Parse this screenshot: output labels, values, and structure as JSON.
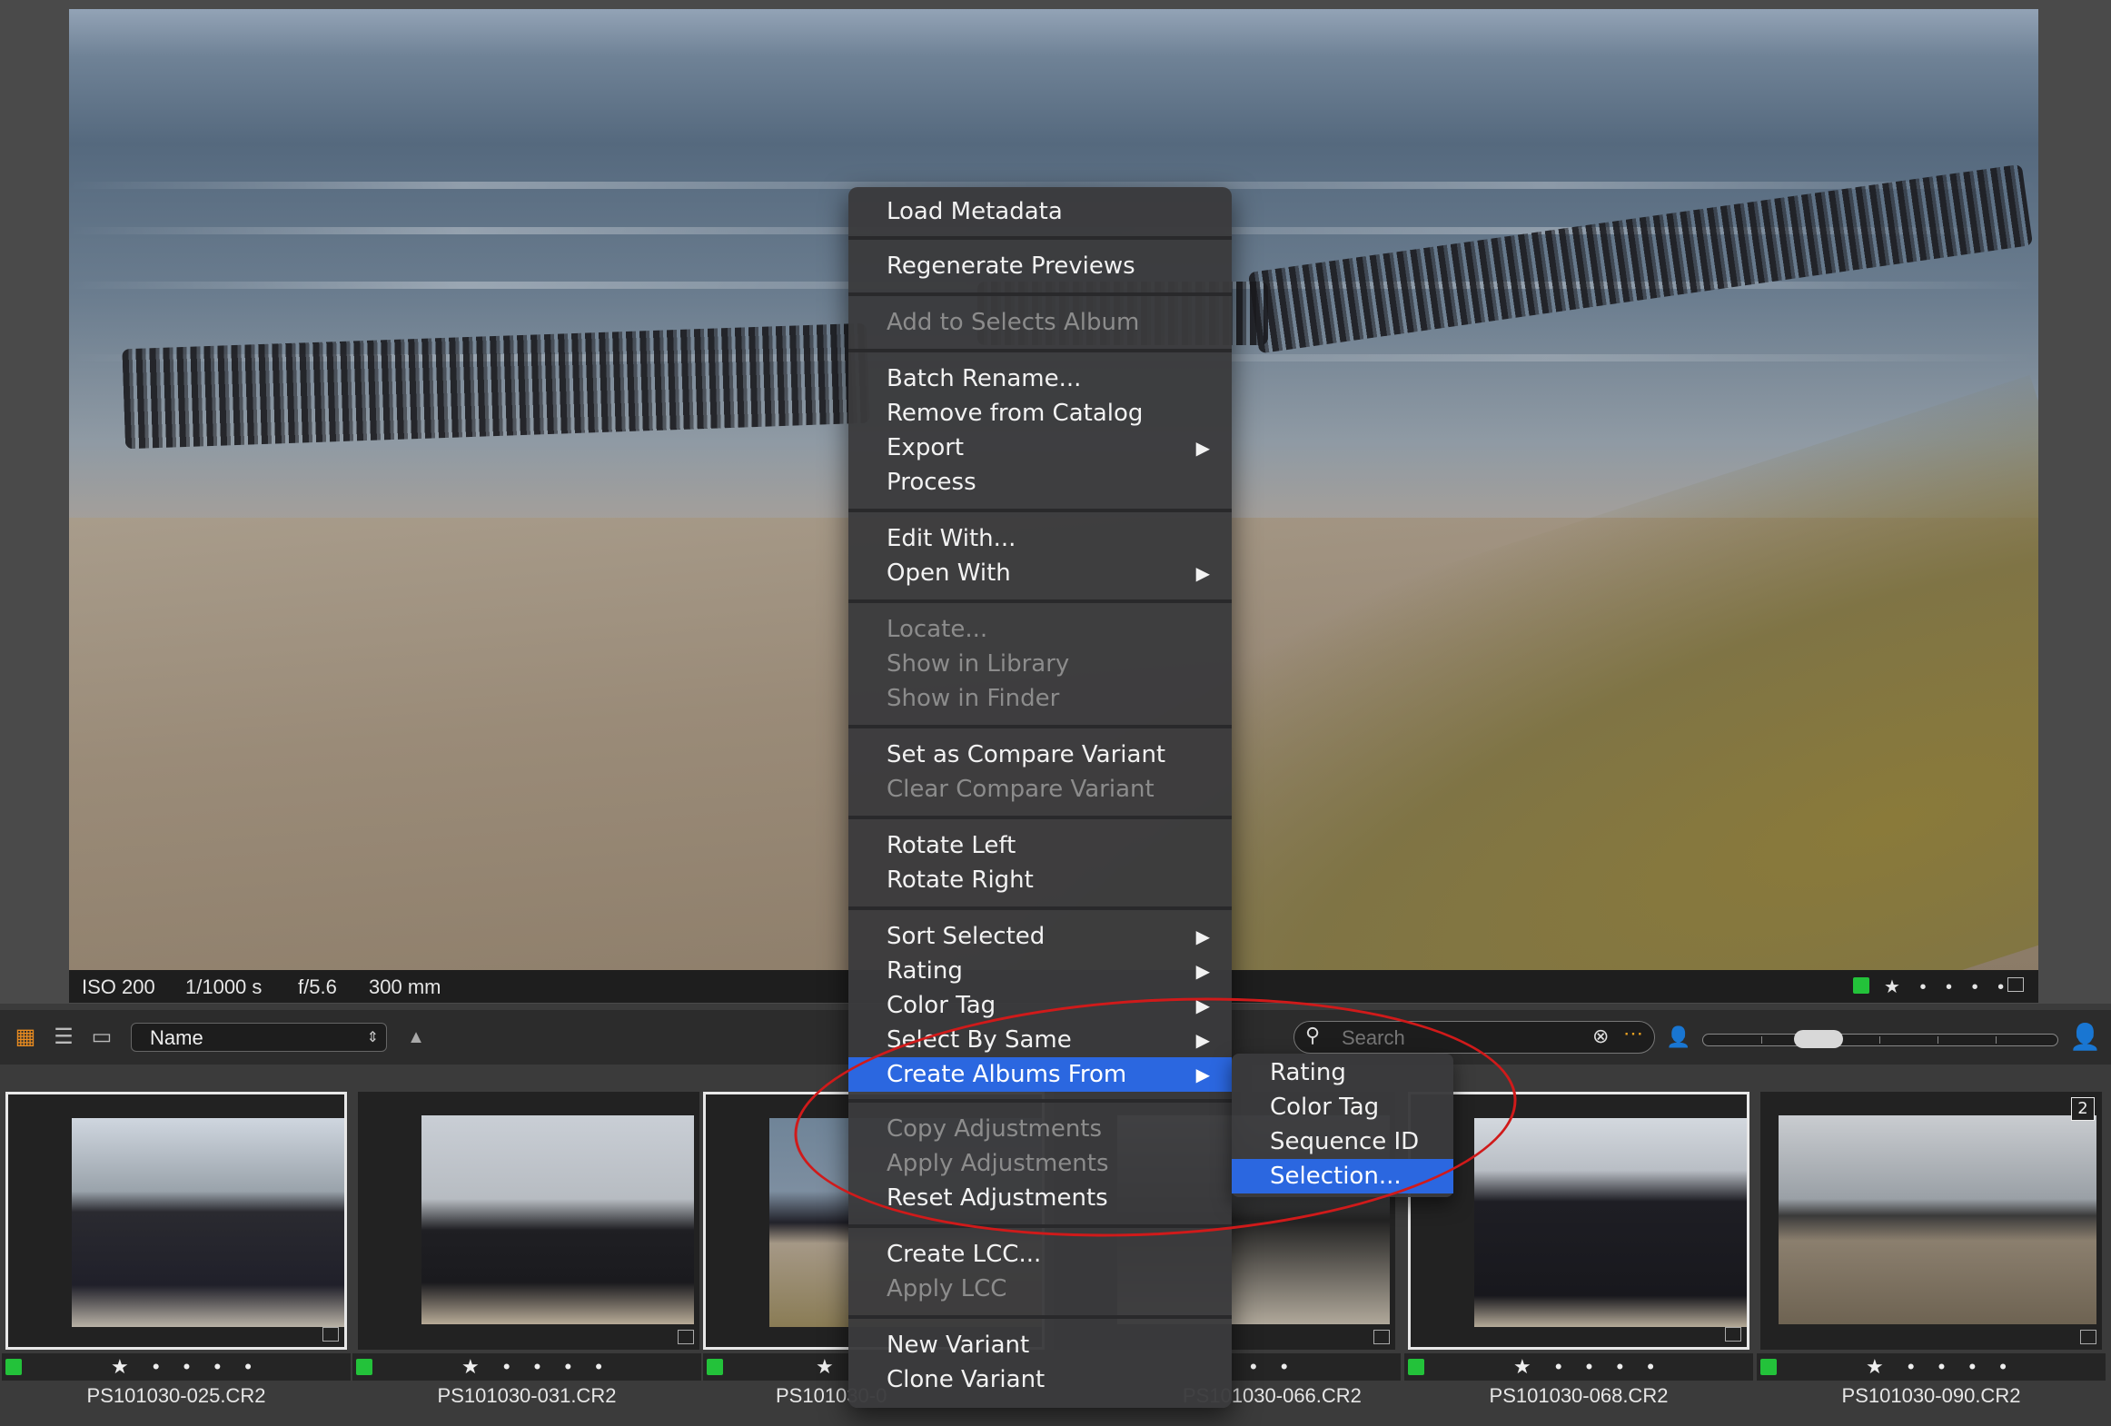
{
  "exif": {
    "iso": "ISO 200",
    "shutter": "1/1000 s",
    "aperture": "f/5.6",
    "focal": "300 mm",
    "stars": "★ • • • •"
  },
  "toolbar": {
    "sort_label": "Name",
    "sort_arrow": "▲",
    "search_placeholder": "Search"
  },
  "context_menu": {
    "load_metadata": "Load Metadata",
    "regenerate_previews": "Regenerate Previews",
    "add_to_selects_album": "Add to Selects Album",
    "batch_rename": "Batch Rename...",
    "remove_from_catalog": "Remove from Catalog",
    "export": "Export",
    "process": "Process",
    "edit_with": "Edit With...",
    "open_with": "Open With",
    "locate": "Locate...",
    "show_in_library": "Show in Library",
    "show_in_finder": "Show in Finder",
    "set_as_compare_variant": "Set as Compare Variant",
    "clear_compare_variant": "Clear Compare Variant",
    "rotate_left": "Rotate Left",
    "rotate_right": "Rotate Right",
    "sort_selected": "Sort Selected",
    "rating": "Rating",
    "color_tag": "Color Tag",
    "select_by_same": "Select By Same",
    "create_albums_from": "Create Albums From",
    "copy_adjustments": "Copy Adjustments",
    "apply_adjustments": "Apply Adjustments",
    "reset_adjustments": "Reset Adjustments",
    "create_lcc": "Create LCC...",
    "apply_lcc": "Apply LCC",
    "new_variant": "New Variant",
    "clone_variant": "Clone Variant"
  },
  "submenu": {
    "rating": "Rating",
    "color_tag": "Color Tag",
    "sequence_id": "Sequence ID",
    "selection": "Selection..."
  },
  "thumbnails": [
    {
      "name": "PS101030-025.CR2",
      "stars": "★ • • • •"
    },
    {
      "name": "PS101030-031.CR2",
      "stars": "★ • • • •"
    },
    {
      "name": "PS101030-0",
      "stars": "★"
    },
    {
      "name": "PS101030-066.CR2",
      "stars": "• •"
    },
    {
      "name": "PS101030-068.CR2",
      "stars": "★ • • • •"
    },
    {
      "name": "PS101030-090.CR2",
      "stars": "★ • • • •",
      "badge": "2"
    }
  ],
  "colors": {
    "green_tag": "#23c23a",
    "highlight": "#2b67e0",
    "annotation": "#d01a1a"
  }
}
